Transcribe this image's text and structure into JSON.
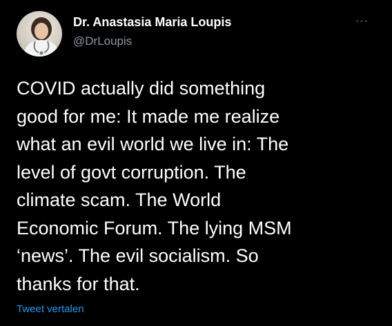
{
  "author": {
    "display_name": "Dr. Anastasia Maria Loupis",
    "handle": "@DrLoupis",
    "avatar_icon": "profile-photo"
  },
  "menu": {
    "more_label": "···"
  },
  "tweet": {
    "lines": [
      "COVID actually did something",
      "good for me: It made me realize",
      "what an evil world we live in: The",
      "level of govt corruption. The",
      "climate scam. The World",
      "Economic Forum. The lying MSM",
      "‘news’. The evil socialism. So",
      "thanks for that."
    ],
    "translate_label": "Tweet vertalen"
  },
  "colors": {
    "background": "#000000",
    "primary_text": "#ffffff",
    "secondary_text": "#8b98a5",
    "link": "#1d9bf0"
  }
}
